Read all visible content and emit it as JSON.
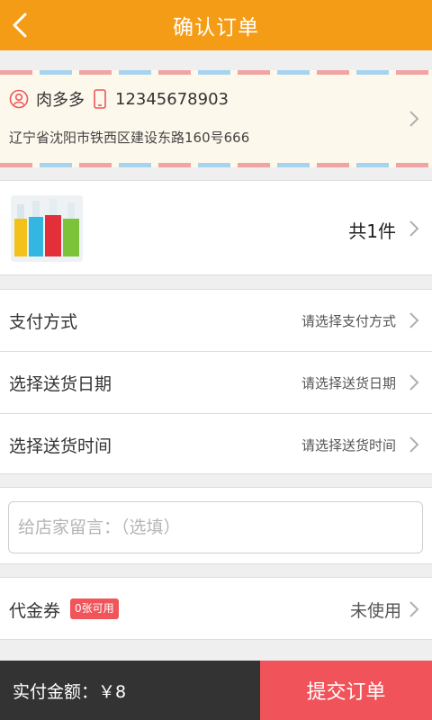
{
  "header": {
    "title": "确认订单"
  },
  "address": {
    "name": "肉多多",
    "phone": "12345678903",
    "detail": "辽宁省沈阳市铁西区建设东路160号666"
  },
  "goods": {
    "count_label": "共1件"
  },
  "options": [
    {
      "label": "支付方式",
      "value": "请选择支付方式"
    },
    {
      "label": "选择送货日期",
      "value": "请选择送货日期"
    },
    {
      "label": "选择送货时间",
      "value": "请选择送货时间"
    }
  ],
  "note": {
    "placeholder": "给店家留言：（选填）"
  },
  "voucher": {
    "label": "代金券",
    "badge": "0张可用",
    "status": "未使用"
  },
  "footer": {
    "total_label": "实付金额：￥8",
    "submit_label": "提交订单"
  },
  "colors": {
    "accent": "#f59c17",
    "submit": "#f0545a",
    "footer_bg": "#333333"
  }
}
